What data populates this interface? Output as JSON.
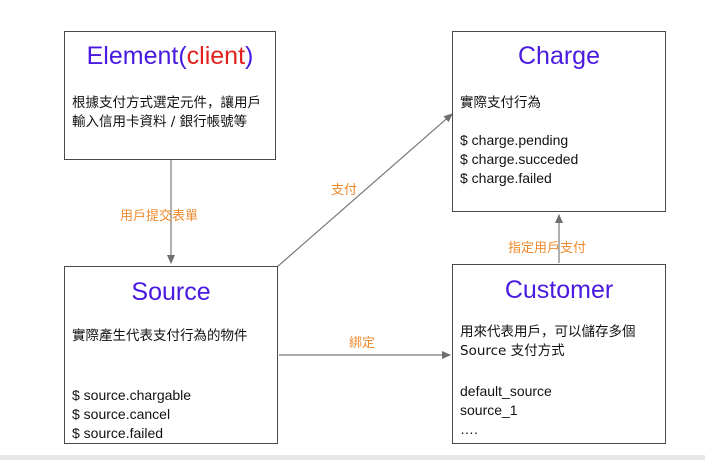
{
  "nodes": {
    "element": {
      "title": "Element(",
      "title_highlight": "client",
      "title_end": ")",
      "description": "根據支付方式選定元件，讓用戶輸入信用卡資料 / 銀行帳號等"
    },
    "charge": {
      "title": "Charge",
      "description": "實際支付行為",
      "items": [
        "$ charge.pending",
        "$ charge.succeded",
        "$ charge.failed"
      ]
    },
    "source": {
      "title": "Source",
      "description": "實際產生代表支付行為的物件",
      "items": [
        "$ source.chargable",
        "$ source.cancel",
        "$ source.failed"
      ]
    },
    "customer": {
      "title": "Customer",
      "description": "用來代表用戶，可以儲存多個Source 支付方式",
      "items": [
        "default_source",
        "source_1",
        "…."
      ]
    }
  },
  "edges": {
    "element_to_source": "用戶提交表單",
    "source_to_charge": "支付",
    "source_to_customer": "綁定",
    "customer_to_charge": "指定用戶支付"
  },
  "colors": {
    "title": "#4a1ae0",
    "title_highlight": "#e0211f",
    "edge_label": "#ef8a2c",
    "border": "#4a4a4a",
    "arrow": "#7a7a7a"
  }
}
